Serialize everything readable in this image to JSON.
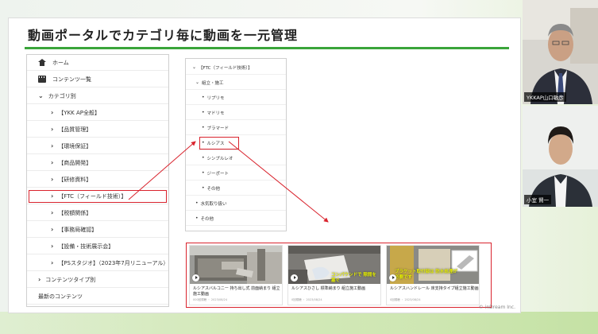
{
  "slide": {
    "title": "動画ポータルでカテゴリ毎に動画を一元管理",
    "copyright": "© inDream Inc."
  },
  "tree": {
    "items": [
      {
        "label": "ホーム",
        "level": 0,
        "icon": "home-icon"
      },
      {
        "label": "コンテンツ一覧",
        "level": 0,
        "icon": "film-icon"
      },
      {
        "label": "カテゴリ別",
        "level": 1,
        "chevron": "⌄"
      },
      {
        "label": "【YKK AP全般】",
        "level": 2,
        "chevron": "›"
      },
      {
        "label": "【品質管理】",
        "level": 2,
        "chevron": "›"
      },
      {
        "label": "【環境保証】",
        "level": 2,
        "chevron": "›"
      },
      {
        "label": "【商品開発】",
        "level": 2,
        "chevron": "›"
      },
      {
        "label": "【研修資料】",
        "level": 2,
        "chevron": "›"
      },
      {
        "label": "【FTC（フィールド技術）】",
        "level": 2,
        "chevron": "›",
        "selected": true
      },
      {
        "label": "【税額関係】",
        "level": 2,
        "chevron": "›"
      },
      {
        "label": "【事務局確認】",
        "level": 2,
        "chevron": "›"
      },
      {
        "label": "【設備・技術展示会】",
        "level": 2,
        "chevron": "›"
      },
      {
        "label": "【PSスタジオ】（2023年7月リニューアル）",
        "level": 2,
        "chevron": "›"
      },
      {
        "label": "コンテンツタイプ別",
        "level": 1,
        "chevron": "›"
      },
      {
        "label": "最新のコンテンツ",
        "level": 0
      }
    ]
  },
  "menu": {
    "items": [
      {
        "label": "【FTC（フィールド技術）】",
        "bullet": "⌄",
        "indent": 0
      },
      {
        "label": "組立・施工",
        "bullet": "⌄",
        "indent": 1
      },
      {
        "label": "リプリモ",
        "bullet": "•",
        "indent": 2
      },
      {
        "label": "マドリモ",
        "bullet": "•",
        "indent": 2
      },
      {
        "label": "プラマード",
        "bullet": "•",
        "indent": 2
      },
      {
        "label": "ルシアス",
        "bullet": "•",
        "indent": 2,
        "selected": true
      },
      {
        "label": "シンプルレオ",
        "bullet": "•",
        "indent": 2
      },
      {
        "label": "ジーポート",
        "bullet": "•",
        "indent": 2
      },
      {
        "label": "その他",
        "bullet": "•",
        "indent": 2
      },
      {
        "label": "水気取り扱い",
        "bullet": "•",
        "indent": 1
      },
      {
        "label": "その他",
        "bullet": "•",
        "indent": 1
      }
    ]
  },
  "cards": [
    {
      "title": "ルシアスバルコニー 持ち出し式 前面納まり 組立施工動画",
      "meta": "000回視聴 ・ 2023/08/24",
      "thumb_text": ""
    },
    {
      "title": "ルシアスひさし 標準納まり 組立施工動画",
      "meta": "0回視聴 ・ 2023/08/24",
      "thumb_text": "コンパウンドで 隙間を塞ぐ"
    },
    {
      "title": "ルシアスハンドレール 床支持タイプ組立施工動画",
      "meta": "0回視聴 ・ 2023/08/24",
      "thumb_text": "ブラケット取付部は 防水処理が必要です"
    }
  ],
  "participants": [
    {
      "name": "YKKAP山口敏彦"
    },
    {
      "name": "小室 賢一"
    }
  ],
  "colors": {
    "accent_green": "#3aa53a",
    "highlight_red": "#d9232d"
  }
}
